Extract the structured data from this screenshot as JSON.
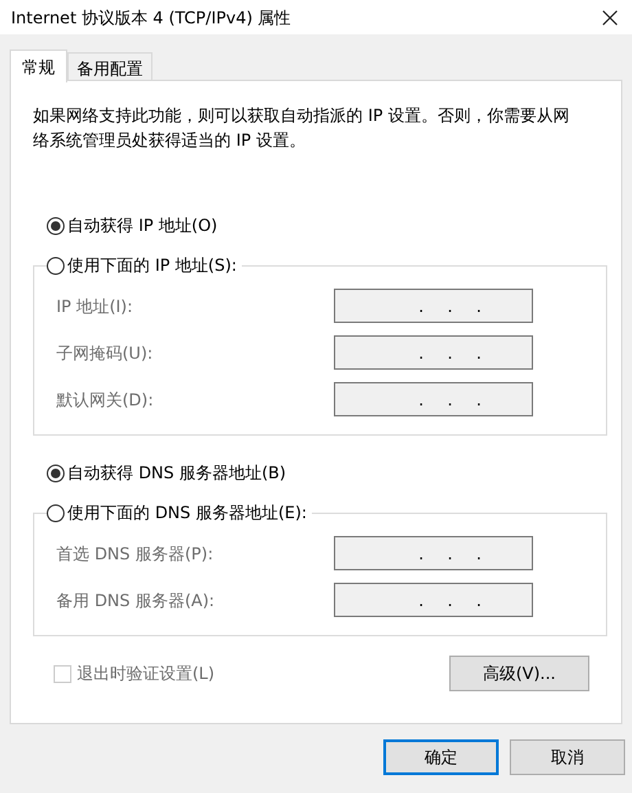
{
  "window": {
    "title": "Internet 协议版本 4 (TCP/IPv4) 属性"
  },
  "tabs": [
    {
      "label": "常规",
      "selected": true
    },
    {
      "label": "备用配置",
      "selected": false
    }
  ],
  "description": "如果网络支持此功能，则可以获取自动指派的 IP 设置。否则，你需要从网络系统管理员处获得适当的 IP 设置。",
  "sections": [
    {
      "options": [
        {
          "label": "自动获得 IP 地址(O)",
          "selected": true
        },
        {
          "label": "使用下面的 IP 地址(S):",
          "selected": false
        }
      ],
      "fields": [
        {
          "label": "IP 地址(I):",
          "disabled": true,
          "separators": [
            ".",
            ".",
            "."
          ]
        },
        {
          "label": "子网掩码(U):",
          "disabled": true,
          "separators": [
            ".",
            ".",
            "."
          ]
        },
        {
          "label": "默认网关(D):",
          "disabled": true,
          "separators": [
            ".",
            ".",
            "."
          ]
        }
      ]
    },
    {
      "options": [
        {
          "label": "自动获得 DNS 服务器地址(B)",
          "selected": true
        },
        {
          "label": "使用下面的 DNS 服务器地址(E):",
          "selected": false
        }
      ],
      "fields": [
        {
          "label": "首选 DNS 服务器(P):",
          "disabled": true,
          "separators": [
            ".",
            ".",
            "."
          ]
        },
        {
          "label": "备用 DNS 服务器(A):",
          "disabled": true,
          "separators": [
            ".",
            ".",
            "."
          ]
        }
      ]
    }
  ],
  "checkbox": {
    "label": "退出时验证设置(L)",
    "checked": false,
    "disabled": true
  },
  "advanced_button": {
    "label": "高级(V)..."
  },
  "dialog_buttons": [
    {
      "label": "确定",
      "default": true
    },
    {
      "label": "取消",
      "default": false
    }
  ]
}
